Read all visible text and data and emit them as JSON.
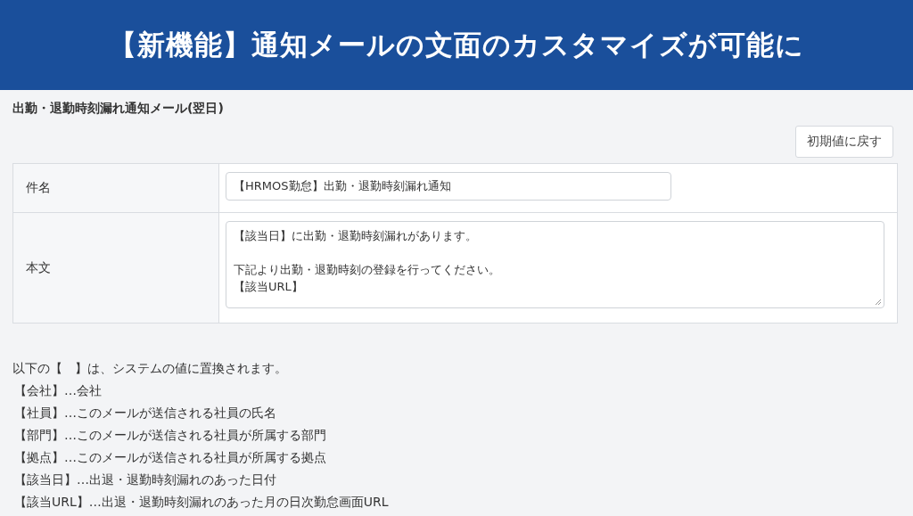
{
  "banner": {
    "title": "【新機能】通知メールの文面のカスタマイズが可能に"
  },
  "section_title": "出勤・退勤時刻漏れ通知メール(翌日)",
  "reset_button": "初期値に戻す",
  "form_rows": [
    {
      "kind": "input",
      "label": "件名",
      "value": "【HRMOS勤怠】出勤・退勤時刻漏れ通知"
    },
    {
      "kind": "textarea",
      "label": "本文",
      "paragraphs": [
        [
          "【該当日】に出勤・退勤時刻漏れがあります。"
        ],
        [
          "下記より出勤・退勤時刻の登録を行ってください。",
          "【該当URL】"
        ]
      ]
    }
  ],
  "notes": {
    "intro": "以下の【　】は、システムの値に置換されます。",
    "items": [
      "【会社】…会社",
      "【社員】…このメールが送信される社員の氏名",
      "【部門】…このメールが送信される社員が所属する部門",
      "【拠点】…このメールが送信される社員が所属する拠点",
      "【該当日】…出退・退勤時刻漏れのあった日付",
      "【該当URL】…出退・退勤時刻漏れのあった月の日次勤怠画面URL"
    ]
  }
}
